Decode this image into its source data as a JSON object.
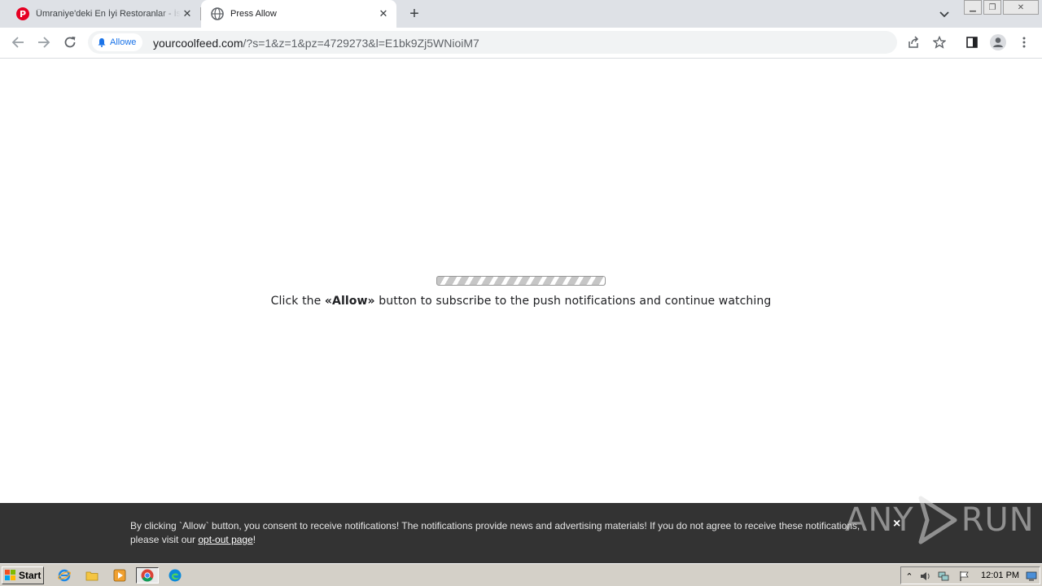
{
  "browser": {
    "tabs": [
      {
        "title": "Ümraniye'deki En İyi Restoranlar - İs",
        "favicon": "pinterest-icon"
      },
      {
        "title": "Press Allow",
        "favicon": "globe-icon"
      }
    ],
    "site_chip_label": "Allowe",
    "url_host": "yourcoolfeed.com",
    "url_path": "/?s=1&z=1&pz=4729273&l=E1bk9Zj5WNioiM7"
  },
  "page": {
    "instruction_before": "Click the ",
    "instruction_bold": "«Allow»",
    "instruction_after": " button to subscribe to the push notifications and continue watching"
  },
  "banner": {
    "text": "By clicking `Allow` button, you consent to receive notifications! The notifications provide news and advertising materials! If you do not agree to receive these notifications, please visit our ",
    "link_text": "opt-out page",
    "text_end": "!",
    "close_label": "×"
  },
  "watermark": {
    "left": "ANY",
    "right": "RUN"
  },
  "taskbar": {
    "start_label": "Start",
    "clock": "12:01 PM"
  },
  "colors": {
    "tabstrip": "#dee1e6",
    "banner": "#333333",
    "accent": "#1a73e8",
    "taskbar": "#d4d0c8"
  }
}
